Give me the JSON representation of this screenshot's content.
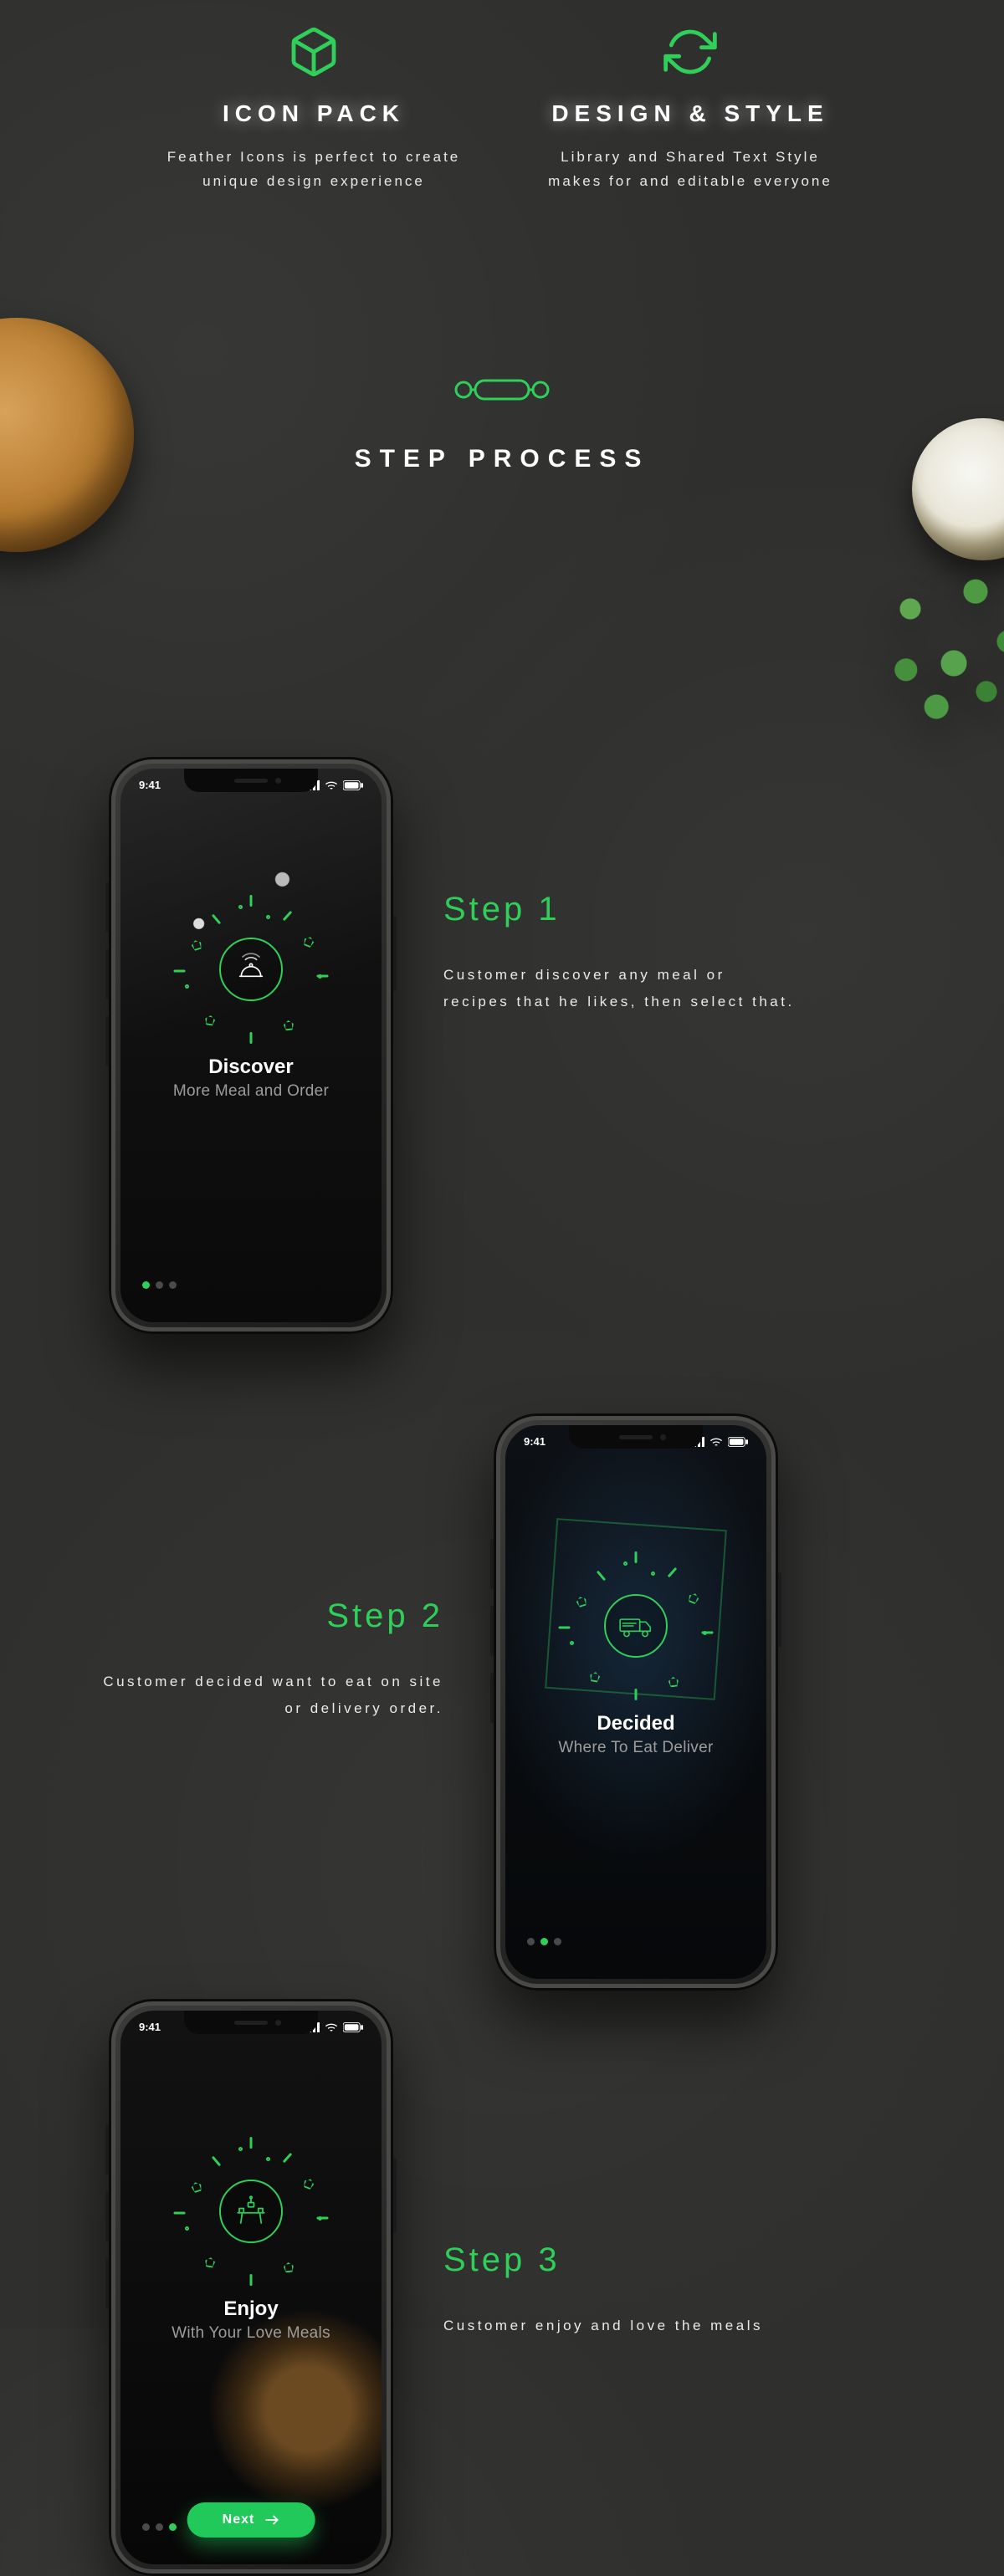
{
  "features": [
    {
      "title": "ICON PACK",
      "desc": "Feather Icons is perfect to create unique design experience"
    },
    {
      "title": "DESIGN & STYLE",
      "desc": "Library and Shared Text Style makes for and editable everyone"
    }
  ],
  "section_title": "STEP PROCESS",
  "statusbar_time": "9:41",
  "steps": [
    {
      "label": "Step 1",
      "desc": "Customer discover any meal or recipes that he likes, then select that.",
      "phone": {
        "title": "Discover",
        "subtitle": "More Meal and Order",
        "active_dot": 0,
        "show_next": false
      }
    },
    {
      "label": "Step 2",
      "desc": "Customer decided want to eat on site or delivery order.",
      "phone": {
        "title": "Decided",
        "subtitle": "Where To Eat Deliver",
        "active_dot": 1,
        "show_next": false
      }
    },
    {
      "label": "Step 3",
      "desc": "Customer enjoy and love the meals",
      "phone": {
        "title": "Enjoy",
        "subtitle": "With Your Love Meals",
        "active_dot": 2,
        "show_next": true,
        "next_label": "Next"
      }
    }
  ]
}
